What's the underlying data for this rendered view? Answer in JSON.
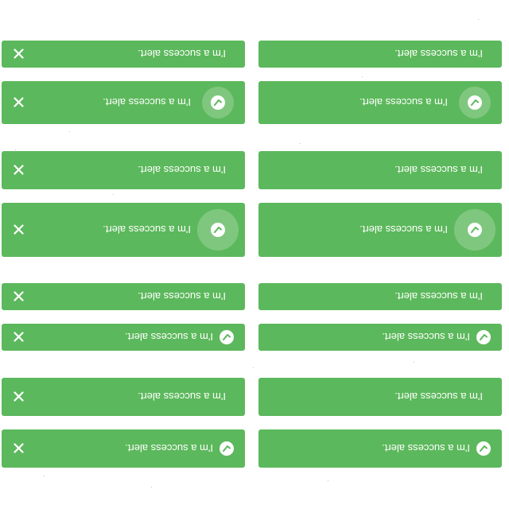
{
  "theme": {
    "success_bg": "#5cb85c",
    "text_color": "#ffffff"
  },
  "alerts": {
    "message": "I'm a success alert.",
    "close_icon": "close-icon",
    "check_icon": "check-circle-icon",
    "items": [
      {
        "variant": "plain-dismissible",
        "message": "I'm a success alert."
      },
      {
        "variant": "plain",
        "message": "I'm a success alert."
      },
      {
        "variant": "icon-large-dismissible",
        "message": "I'm a success alert."
      },
      {
        "variant": "icon-large",
        "message": "I'm a success alert."
      },
      {
        "variant": "plain-dismissible",
        "message": "I'm a success alert."
      },
      {
        "variant": "plain",
        "message": "I'm a success alert."
      },
      {
        "variant": "icon-large-dismissible",
        "message": "I'm a success alert."
      },
      {
        "variant": "icon-large",
        "message": "I'm a success alert."
      },
      {
        "variant": "plain-dismissible",
        "message": "I'm a success alert."
      },
      {
        "variant": "plain",
        "message": "I'm a success alert."
      },
      {
        "variant": "icon-small-dismissible",
        "message": "I'm a success alert."
      },
      {
        "variant": "icon-small",
        "message": "I'm a success alert."
      },
      {
        "variant": "plain-dismissible",
        "message": "I'm a success alert."
      },
      {
        "variant": "plain",
        "message": "I'm a success alert."
      },
      {
        "variant": "icon-small-dismissible",
        "message": "I'm a success alert."
      },
      {
        "variant": "icon-small",
        "message": "I'm a success alert."
      }
    ]
  }
}
